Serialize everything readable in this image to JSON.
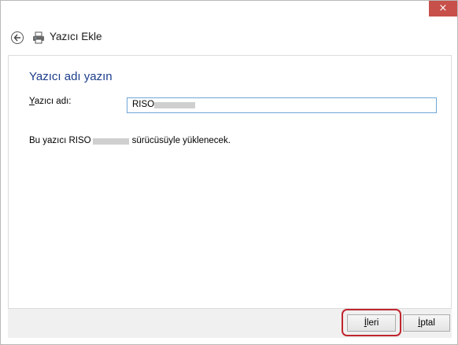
{
  "window": {
    "title": "Yazıcı Ekle",
    "close_glyph": "×",
    "close_color": "#c7504b"
  },
  "page": {
    "heading": "Yazıcı adı yazın",
    "heading_color": "#1b3d8a",
    "field_label_access": "Y",
    "field_label_rest": "azıcı adı:",
    "printer_name_value": "RISO",
    "driver_message_prefix": "Bu yazıcı RISO",
    "driver_message_suffix": "sürücüsüyle yüklenecek."
  },
  "footer": {
    "next_access": "İ",
    "next_rest": "leri",
    "cancel_access": "İ",
    "cancel_rest": "ptal",
    "highlight_color": "#c0262e"
  },
  "icons": {
    "back": "back-arrow-icon",
    "printer": "printer-icon",
    "close": "close-icon"
  }
}
